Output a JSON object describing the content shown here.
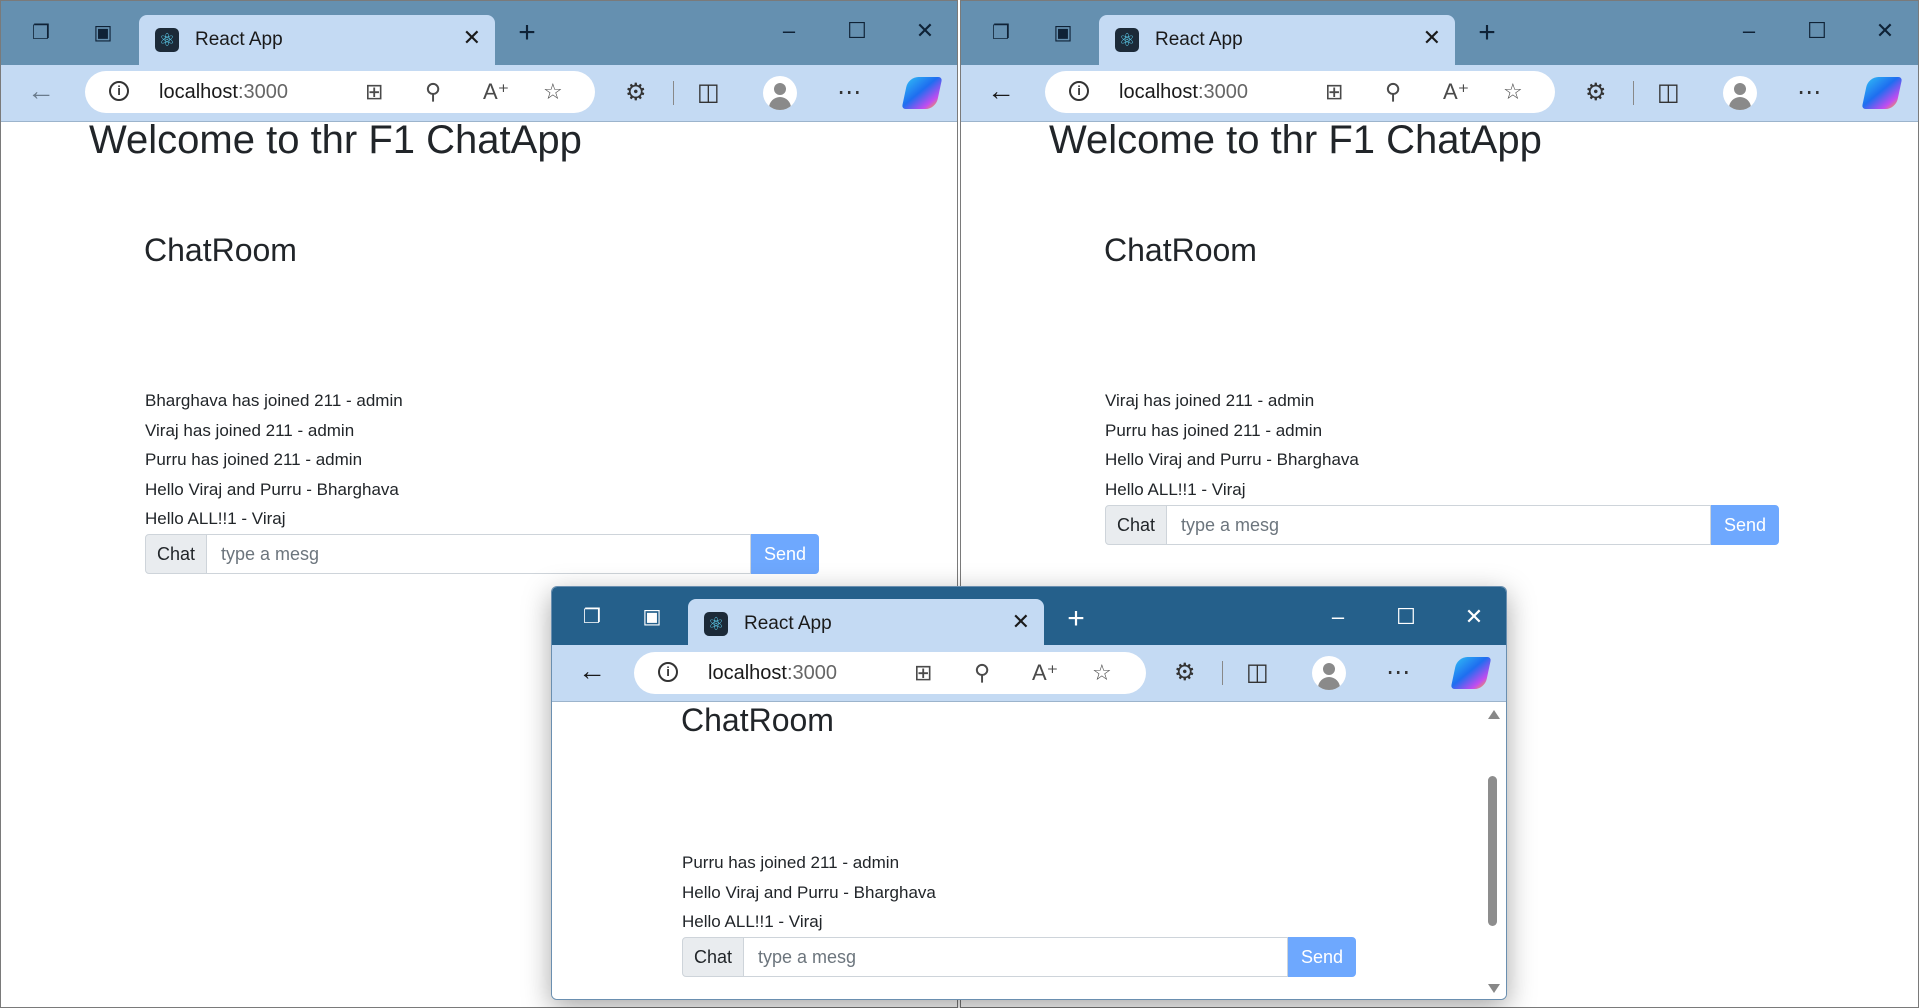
{
  "browser": {
    "tab_title": "React App",
    "url_host": "localhost",
    "url_port": ":3000",
    "icons": {
      "workspaces": "workspaces-icon",
      "tab_actions": "tab-actions-icon",
      "favicon": "react-logo-icon",
      "close_tab": "close-icon",
      "new_tab": "plus-icon",
      "minimize": "minimize-icon",
      "maximize": "maximize-icon",
      "close_window": "close-window-icon",
      "back": "back-arrow-icon",
      "site_info": "info-icon",
      "apps": "app-grid-icon",
      "zoom": "zoom-out-icon",
      "read_aloud": "read-aloud-icon",
      "favorite": "star-icon",
      "extensions": "extensions-icon",
      "split_screen": "split-screen-icon",
      "profile": "profile-avatar",
      "more": "more-dots-icon",
      "copilot": "copilot-icon"
    }
  },
  "colors": {
    "titlebar_inactive": "#6590b0",
    "titlebar_active": "#25608b",
    "toolbar": "#c4daf3",
    "send_button": "#6ea8fe"
  },
  "windows": {
    "left": {
      "page_title": "Welcome to thr F1 ChatApp",
      "room_title": "ChatRoom",
      "messages": [
        "Bharghava has joined 211 - admin",
        "Viraj has joined 211 - admin",
        "Purru has joined 211 - admin",
        "Hello Viraj and Purru - Bharghava",
        "Hello ALL!!1 - Viraj"
      ],
      "chat_label": "Chat",
      "placeholder": "type a mesg",
      "send_label": "Send"
    },
    "right": {
      "page_title": "Welcome to thr F1 ChatApp",
      "room_title": "ChatRoom",
      "messages": [
        "Viraj has joined 211 - admin",
        "Purru has joined 211 - admin",
        "Hello Viraj and Purru - Bharghava",
        "Hello ALL!!1 - Viraj"
      ],
      "chat_label": "Chat",
      "placeholder": "type a mesg",
      "send_label": "Send"
    },
    "front": {
      "room_title": "ChatRoom",
      "messages": [
        "Purru has joined 211 - admin",
        "Hello Viraj and Purru - Bharghava",
        "Hello ALL!!1 - Viraj"
      ],
      "chat_label": "Chat",
      "placeholder": "type a mesg",
      "send_label": "Send"
    }
  }
}
